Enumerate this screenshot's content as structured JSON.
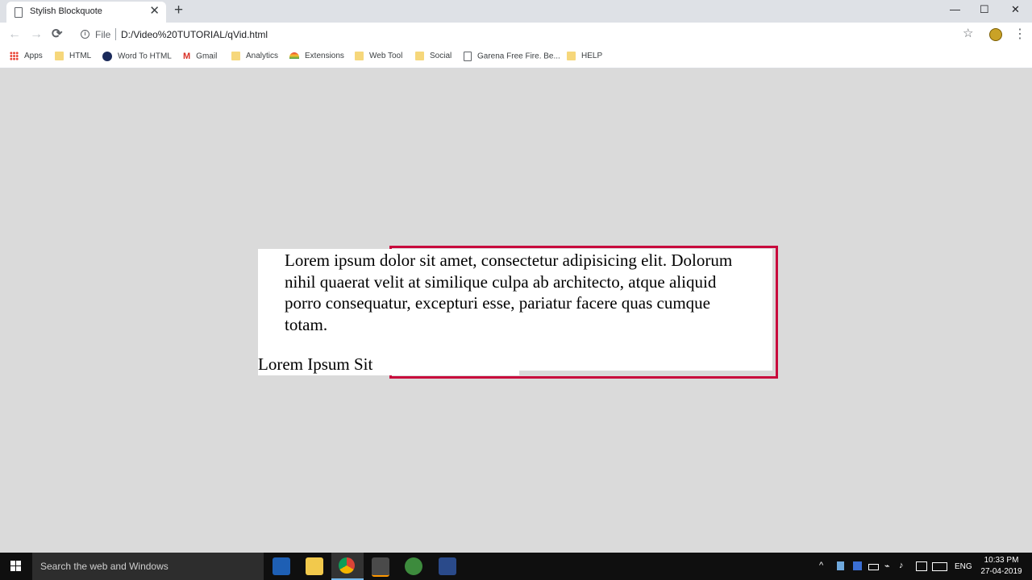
{
  "tab": {
    "title": "Stylish Blockquote",
    "close": "✕",
    "new": "+"
  },
  "window": {
    "minimize": "—",
    "maximize": "☐",
    "close": "✕"
  },
  "toolbar": {
    "back": "←",
    "forward": "→",
    "reload": "⟳",
    "info": "i",
    "scheme": "File",
    "url": "D:/Video%20TUTORIAL/qVid.html",
    "star": "☆",
    "menu": "⋮"
  },
  "bookmarks": [
    {
      "label": "Apps",
      "icon": "apps-icon"
    },
    {
      "label": "HTML",
      "icon": "folder-icon"
    },
    {
      "label": "Word To HTML",
      "icon": "wordtohtml-icon"
    },
    {
      "label": "Gmail",
      "icon": "gmail-icon"
    },
    {
      "label": "Analytics",
      "icon": "folder-icon"
    },
    {
      "label": "Extensions",
      "icon": "rainbow-icon"
    },
    {
      "label": "Web Tool",
      "icon": "folder-icon"
    },
    {
      "label": "Social",
      "icon": "folder-icon"
    },
    {
      "label": "Garena Free Fire. Be...",
      "icon": "page-icon"
    },
    {
      "label": "HELP",
      "icon": "folder-icon"
    }
  ],
  "page": {
    "quote": "Lorem ipsum dolor sit amet, consectetur adipisicing elit. Dolorum nihil quaerat velit at similique culpa ab architecto, atque aliquid porro consequatur, excepturi esse, pariatur facere quas cumque totam.",
    "author": "Lorem Ipsum Sit",
    "accent_color": "#c8093c"
  },
  "taskbar": {
    "search_placeholder": "Search the web and Windows",
    "lang": "ENG",
    "time": "10:33 PM",
    "date": "27-04-2019"
  }
}
